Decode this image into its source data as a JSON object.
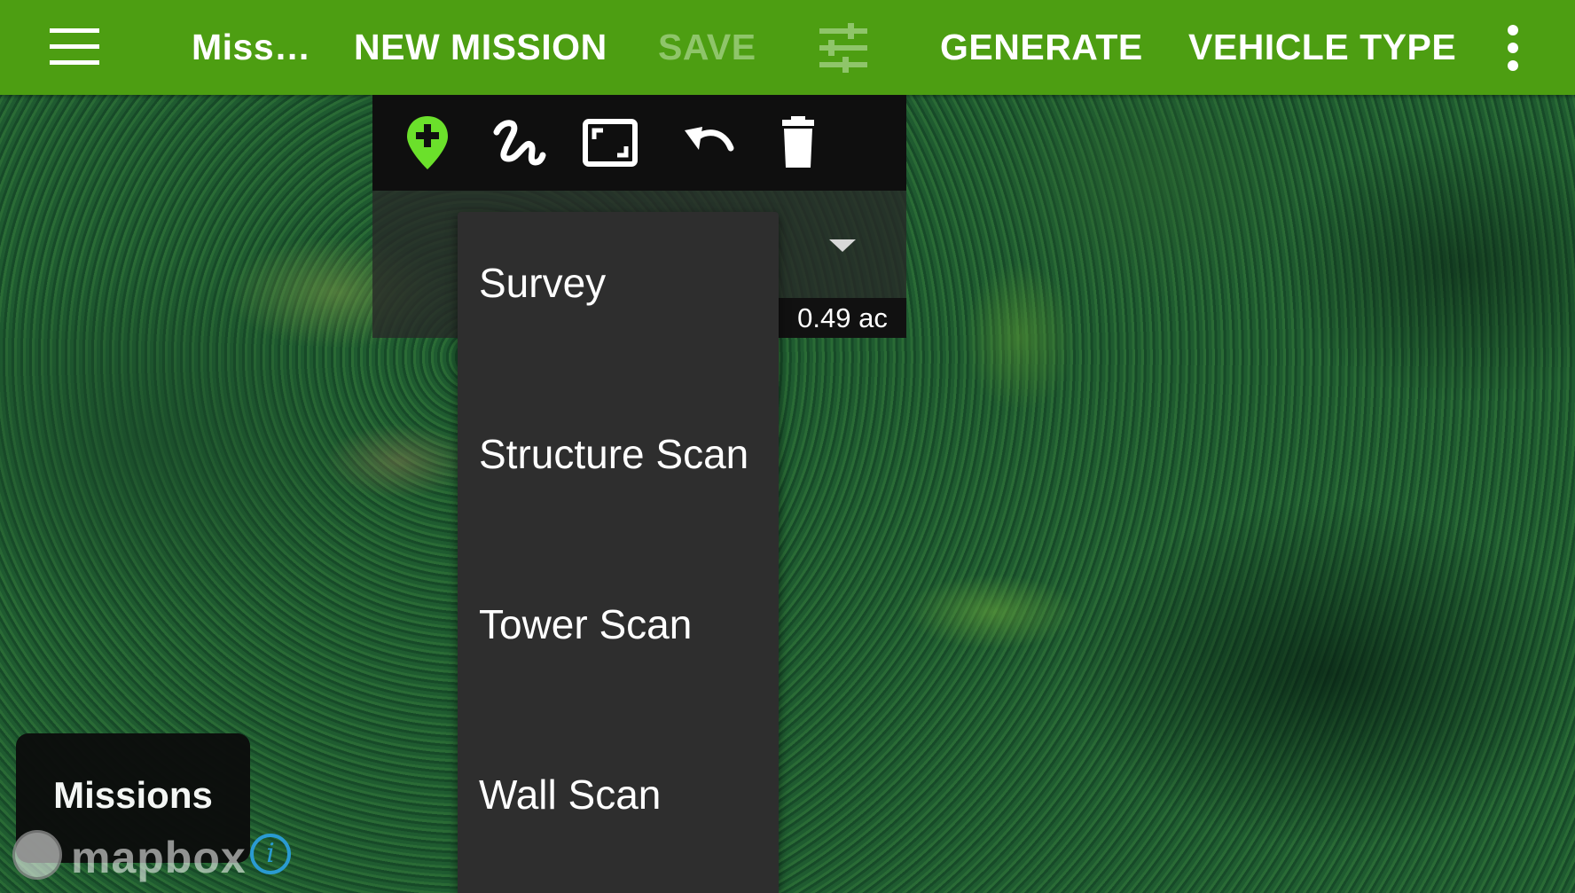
{
  "appbar": {
    "title": "Miss…",
    "new_mission": "NEW MISSION",
    "save": "SAVE",
    "generate": "GENERATE",
    "vehicle_type": "VEHICLE TYPE"
  },
  "toolbar": {
    "tools": [
      "add-waypoint-icon",
      "draw-path-icon",
      "fit-to-screen-icon",
      "undo-icon",
      "delete-icon"
    ]
  },
  "mission_type": {
    "selected": "Survey",
    "area": "0.49 ac",
    "options": [
      "Survey",
      "Structure Scan",
      "Tower Scan",
      "Wall Scan"
    ]
  },
  "missions_button": {
    "label": "Missions"
  },
  "attribution": {
    "logo_text": "mapbox",
    "info": "i"
  },
  "colors": {
    "appbar": "#4d9e12",
    "accent_pin": "#6be02b",
    "dropdown_bg": "#2e2e2e",
    "info_blue": "#2a9bd2"
  }
}
